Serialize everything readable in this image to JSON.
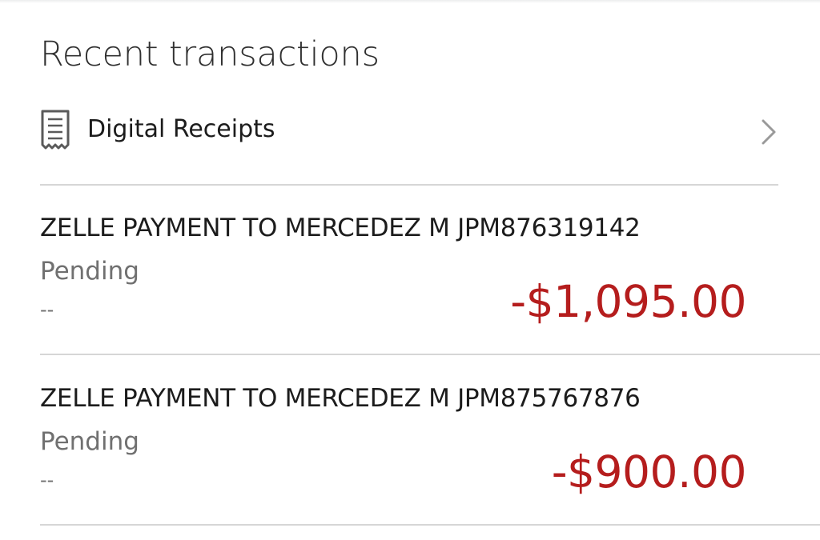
{
  "section": {
    "title": "Recent transactions"
  },
  "receipts": {
    "label": "Digital Receipts",
    "icon": "receipt-icon",
    "chevron_icon": "chevron-right-icon"
  },
  "colors": {
    "amount_negative": "#b51d1d",
    "status_text": "#707070",
    "divider": "#d6d6d6"
  },
  "transactions": [
    {
      "description": "ZELLE PAYMENT TO MERCEDEZ M JPM876319142",
      "status": "Pending",
      "date": "--",
      "amount": "-$1,095.00"
    },
    {
      "description": "ZELLE PAYMENT TO MERCEDEZ M JPM875767876",
      "status": "Pending",
      "date": "--",
      "amount": "-$900.00"
    }
  ]
}
